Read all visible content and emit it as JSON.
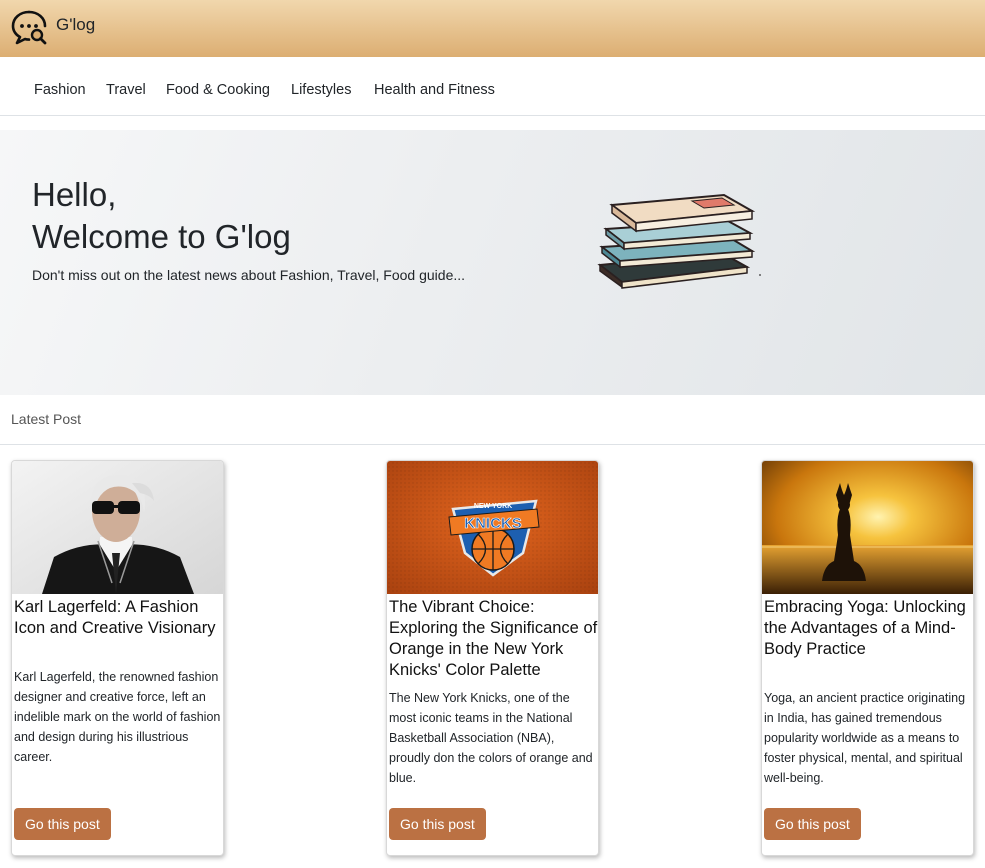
{
  "brand": {
    "name": "G'log",
    "icon": "chat-bubble-search-icon"
  },
  "nav": {
    "items": [
      "Fashion",
      "Travel",
      "Food & Cooking",
      "Lifestyles",
      "Health and Fitness"
    ]
  },
  "hero": {
    "title_line1": "Hello,",
    "title_line2": "Welcome to G'log",
    "subtitle": "Don't miss out on the latest news about Fashion, Travel, Food guide...",
    "image": "stack-of-books-illustration"
  },
  "latest": {
    "label": "Latest Post",
    "posts": [
      {
        "image": "karl-lagerfeld-portrait",
        "title": "Karl Lagerfeld: A Fashion Icon and Creative Visionary",
        "text": "Karl Lagerfeld, the renowned fashion designer and creative force, left an indelible mark on the world of fashion and design during his illustrious career.",
        "button": "Go this post"
      },
      {
        "image": "new-york-knicks-logo-orange-jersey",
        "title": "The Vibrant Choice: Exploring the Significance of Orange in the New York Knicks' Color Palette",
        "text": "The New York Knicks, one of the most iconic teams in the National Basketball Association (NBA), proudly don the colors of orange and blue.",
        "button": "Go this post"
      },
      {
        "image": "yoga-silhouette-sunset",
        "title": "Embracing Yoga: Unlocking the Advantages of a Mind-Body Practice",
        "text": "Yoga, an ancient practice originating in India, has gained tremendous popularity worldwide as a means to foster physical, mental, and spiritual well-being.",
        "button": "Go this post"
      }
    ]
  },
  "colors": {
    "header_top": "#f1d7ad",
    "header_bottom": "#dcae72",
    "button": "#bb7143"
  }
}
